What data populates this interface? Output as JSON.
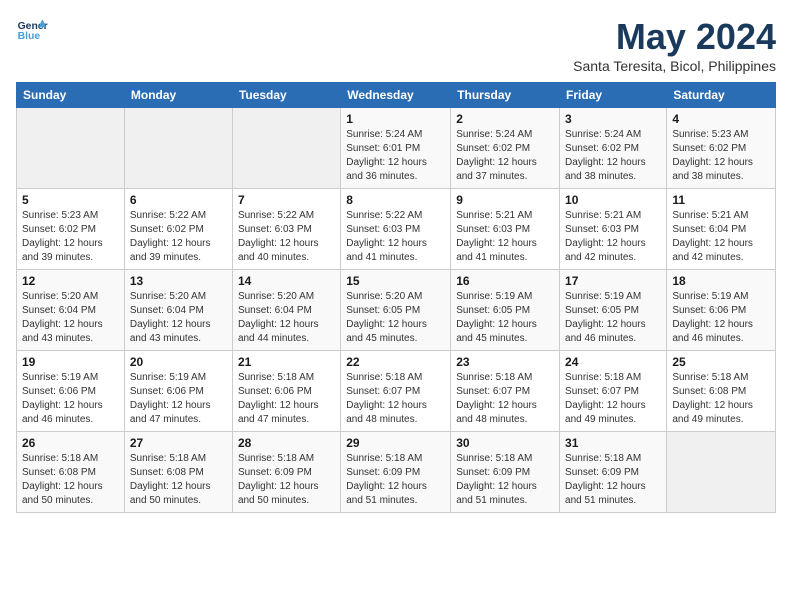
{
  "logo": {
    "line1": "General",
    "line2": "Blue"
  },
  "title": "May 2024",
  "subtitle": "Santa Teresita, Bicol, Philippines",
  "days_of_week": [
    "Sunday",
    "Monday",
    "Tuesday",
    "Wednesday",
    "Thursday",
    "Friday",
    "Saturday"
  ],
  "weeks": [
    [
      {
        "day": "",
        "info": ""
      },
      {
        "day": "",
        "info": ""
      },
      {
        "day": "",
        "info": ""
      },
      {
        "day": "1",
        "info": "Sunrise: 5:24 AM\nSunset: 6:01 PM\nDaylight: 12 hours\nand 36 minutes."
      },
      {
        "day": "2",
        "info": "Sunrise: 5:24 AM\nSunset: 6:02 PM\nDaylight: 12 hours\nand 37 minutes."
      },
      {
        "day": "3",
        "info": "Sunrise: 5:24 AM\nSunset: 6:02 PM\nDaylight: 12 hours\nand 38 minutes."
      },
      {
        "day": "4",
        "info": "Sunrise: 5:23 AM\nSunset: 6:02 PM\nDaylight: 12 hours\nand 38 minutes."
      }
    ],
    [
      {
        "day": "5",
        "info": "Sunrise: 5:23 AM\nSunset: 6:02 PM\nDaylight: 12 hours\nand 39 minutes."
      },
      {
        "day": "6",
        "info": "Sunrise: 5:22 AM\nSunset: 6:02 PM\nDaylight: 12 hours\nand 39 minutes."
      },
      {
        "day": "7",
        "info": "Sunrise: 5:22 AM\nSunset: 6:03 PM\nDaylight: 12 hours\nand 40 minutes."
      },
      {
        "day": "8",
        "info": "Sunrise: 5:22 AM\nSunset: 6:03 PM\nDaylight: 12 hours\nand 41 minutes."
      },
      {
        "day": "9",
        "info": "Sunrise: 5:21 AM\nSunset: 6:03 PM\nDaylight: 12 hours\nand 41 minutes."
      },
      {
        "day": "10",
        "info": "Sunrise: 5:21 AM\nSunset: 6:03 PM\nDaylight: 12 hours\nand 42 minutes."
      },
      {
        "day": "11",
        "info": "Sunrise: 5:21 AM\nSunset: 6:04 PM\nDaylight: 12 hours\nand 42 minutes."
      }
    ],
    [
      {
        "day": "12",
        "info": "Sunrise: 5:20 AM\nSunset: 6:04 PM\nDaylight: 12 hours\nand 43 minutes."
      },
      {
        "day": "13",
        "info": "Sunrise: 5:20 AM\nSunset: 6:04 PM\nDaylight: 12 hours\nand 43 minutes."
      },
      {
        "day": "14",
        "info": "Sunrise: 5:20 AM\nSunset: 6:04 PM\nDaylight: 12 hours\nand 44 minutes."
      },
      {
        "day": "15",
        "info": "Sunrise: 5:20 AM\nSunset: 6:05 PM\nDaylight: 12 hours\nand 45 minutes."
      },
      {
        "day": "16",
        "info": "Sunrise: 5:19 AM\nSunset: 6:05 PM\nDaylight: 12 hours\nand 45 minutes."
      },
      {
        "day": "17",
        "info": "Sunrise: 5:19 AM\nSunset: 6:05 PM\nDaylight: 12 hours\nand 46 minutes."
      },
      {
        "day": "18",
        "info": "Sunrise: 5:19 AM\nSunset: 6:06 PM\nDaylight: 12 hours\nand 46 minutes."
      }
    ],
    [
      {
        "day": "19",
        "info": "Sunrise: 5:19 AM\nSunset: 6:06 PM\nDaylight: 12 hours\nand 46 minutes."
      },
      {
        "day": "20",
        "info": "Sunrise: 5:19 AM\nSunset: 6:06 PM\nDaylight: 12 hours\nand 47 minutes."
      },
      {
        "day": "21",
        "info": "Sunrise: 5:18 AM\nSunset: 6:06 PM\nDaylight: 12 hours\nand 47 minutes."
      },
      {
        "day": "22",
        "info": "Sunrise: 5:18 AM\nSunset: 6:07 PM\nDaylight: 12 hours\nand 48 minutes."
      },
      {
        "day": "23",
        "info": "Sunrise: 5:18 AM\nSunset: 6:07 PM\nDaylight: 12 hours\nand 48 minutes."
      },
      {
        "day": "24",
        "info": "Sunrise: 5:18 AM\nSunset: 6:07 PM\nDaylight: 12 hours\nand 49 minutes."
      },
      {
        "day": "25",
        "info": "Sunrise: 5:18 AM\nSunset: 6:08 PM\nDaylight: 12 hours\nand 49 minutes."
      }
    ],
    [
      {
        "day": "26",
        "info": "Sunrise: 5:18 AM\nSunset: 6:08 PM\nDaylight: 12 hours\nand 50 minutes."
      },
      {
        "day": "27",
        "info": "Sunrise: 5:18 AM\nSunset: 6:08 PM\nDaylight: 12 hours\nand 50 minutes."
      },
      {
        "day": "28",
        "info": "Sunrise: 5:18 AM\nSunset: 6:09 PM\nDaylight: 12 hours\nand 50 minutes."
      },
      {
        "day": "29",
        "info": "Sunrise: 5:18 AM\nSunset: 6:09 PM\nDaylight: 12 hours\nand 51 minutes."
      },
      {
        "day": "30",
        "info": "Sunrise: 5:18 AM\nSunset: 6:09 PM\nDaylight: 12 hours\nand 51 minutes."
      },
      {
        "day": "31",
        "info": "Sunrise: 5:18 AM\nSunset: 6:09 PM\nDaylight: 12 hours\nand 51 minutes."
      },
      {
        "day": "",
        "info": ""
      }
    ]
  ]
}
